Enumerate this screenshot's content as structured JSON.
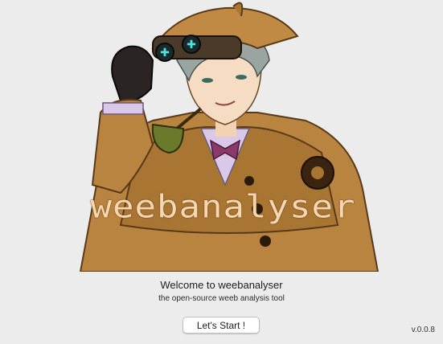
{
  "hero": {
    "logo_text": "weebanalyser",
    "image_name": "detective-character-illustration"
  },
  "welcome": {
    "title": "Welcome to weebanalyser",
    "subtitle": "the open-source weeb analysis tool"
  },
  "actions": {
    "start_label": "Let's Start !"
  },
  "footer": {
    "version": "v.0.0.8"
  },
  "colors": {
    "background": "#ececec",
    "coat": "#b8843f",
    "logo_text": "#f6d7b0",
    "goggle_glow": "#4fe3e0"
  }
}
